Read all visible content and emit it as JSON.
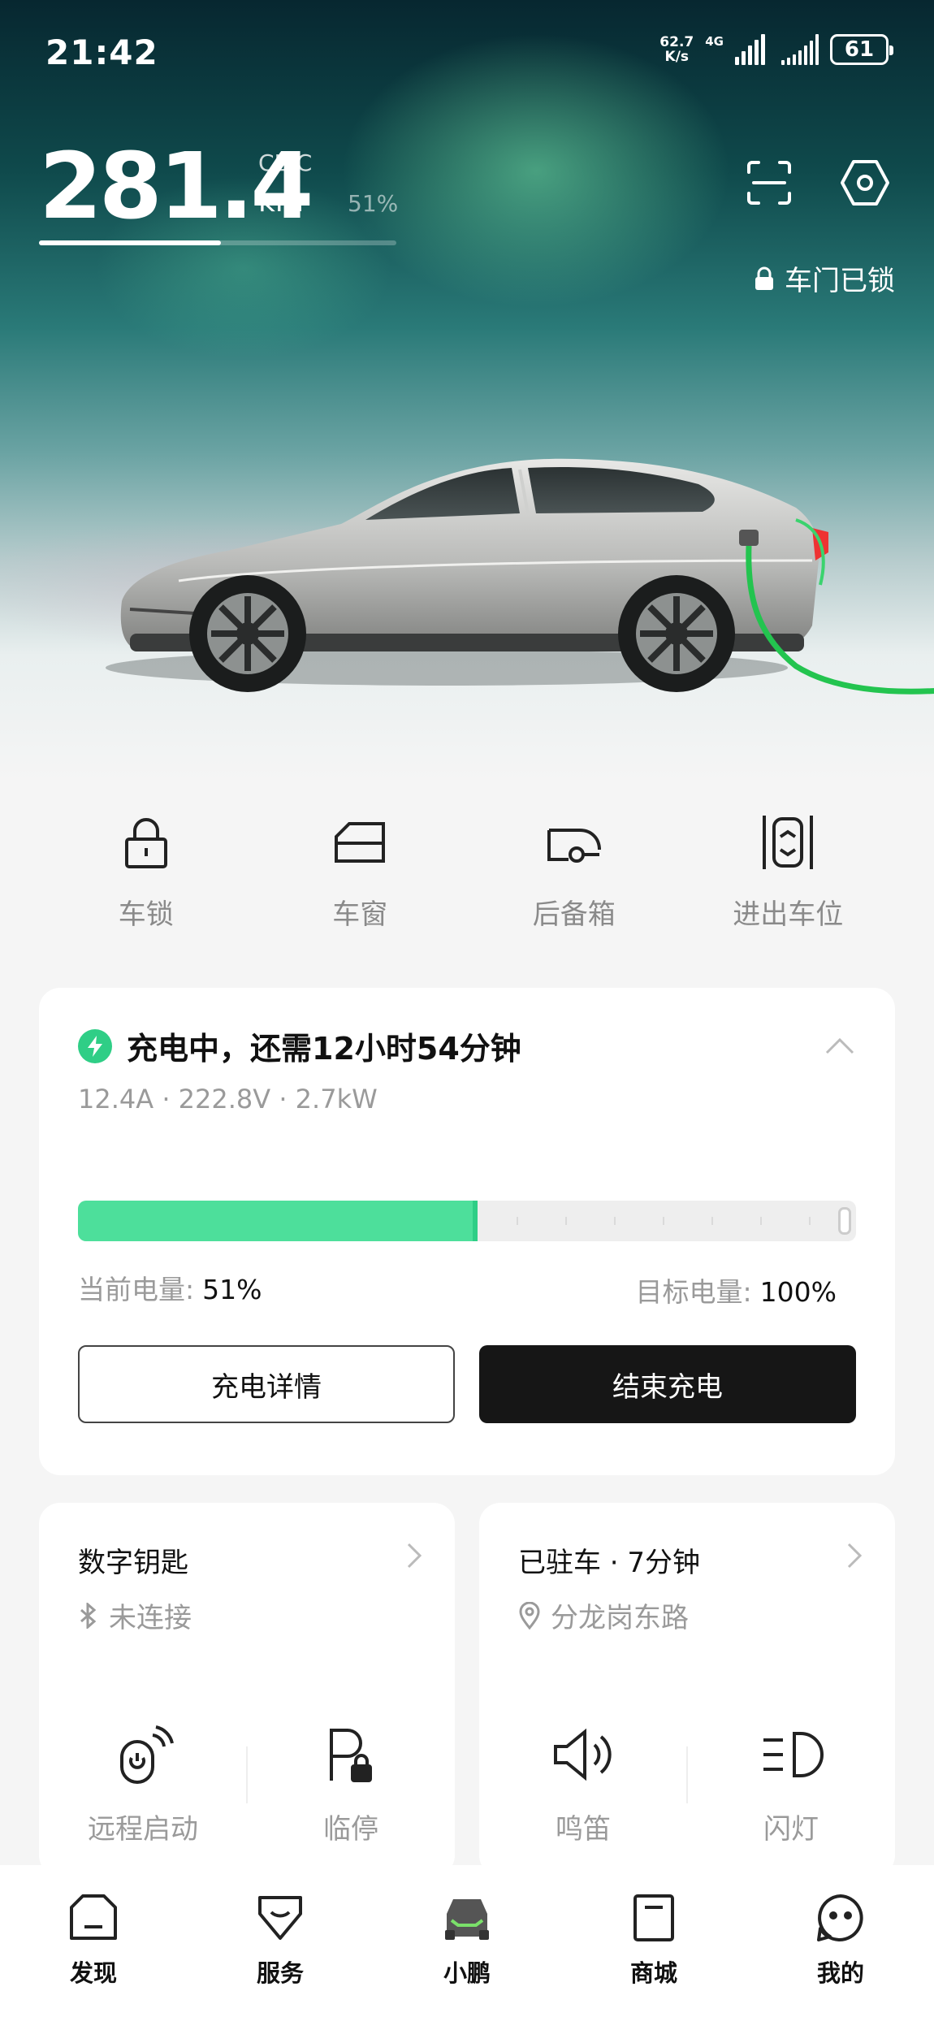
{
  "status_bar": {
    "time": "21:42",
    "net_speed_value": "62.7",
    "net_speed_unit": "K/s",
    "network_type": "4G",
    "battery": "61"
  },
  "range": {
    "value": "281.4",
    "standard": "CLTC",
    "unit": "km",
    "battery_percent": "51%",
    "battery_fraction": 0.51
  },
  "door_status": "车门已锁",
  "quick_actions": [
    {
      "label": "车锁",
      "icon": "lock-icon"
    },
    {
      "label": "车窗",
      "icon": "window-icon"
    },
    {
      "label": "后备箱",
      "icon": "trunk-icon"
    },
    {
      "label": "进出车位",
      "icon": "parking-in-out-icon"
    }
  ],
  "charging": {
    "title": "充电中，还需12小时54分钟",
    "details": "12.4A · 222.8V · 2.7kW",
    "current_label": "当前电量:",
    "current_value": "51%",
    "current_fraction": 0.51,
    "target_label": "目标电量:",
    "target_value": "100%",
    "target_fraction": 1.0,
    "detail_button": "充电详情",
    "stop_button": "结束充电"
  },
  "digital_key": {
    "title": "数字钥匙",
    "status": "未连接",
    "actions": [
      {
        "label": "远程启动",
        "icon": "remote-start-icon"
      },
      {
        "label": "临停",
        "icon": "temporary-parking-icon"
      }
    ]
  },
  "parking": {
    "title": "已驻车 · 7分钟",
    "location": "分龙岗东路",
    "actions": [
      {
        "label": "鸣笛",
        "icon": "horn-icon"
      },
      {
        "label": "闪灯",
        "icon": "flash-lights-icon"
      }
    ]
  },
  "tabs": [
    {
      "label": "发现",
      "icon": "discover-icon"
    },
    {
      "label": "服务",
      "icon": "service-icon"
    },
    {
      "label": "小鹏",
      "icon": "car-icon",
      "active": true
    },
    {
      "label": "商城",
      "icon": "mall-icon"
    },
    {
      "label": "我的",
      "icon": "profile-icon"
    }
  ],
  "colors": {
    "accent_green": "#2fce86",
    "progress_green": "#4ddf9b",
    "stop_button_bg": "#161616"
  }
}
